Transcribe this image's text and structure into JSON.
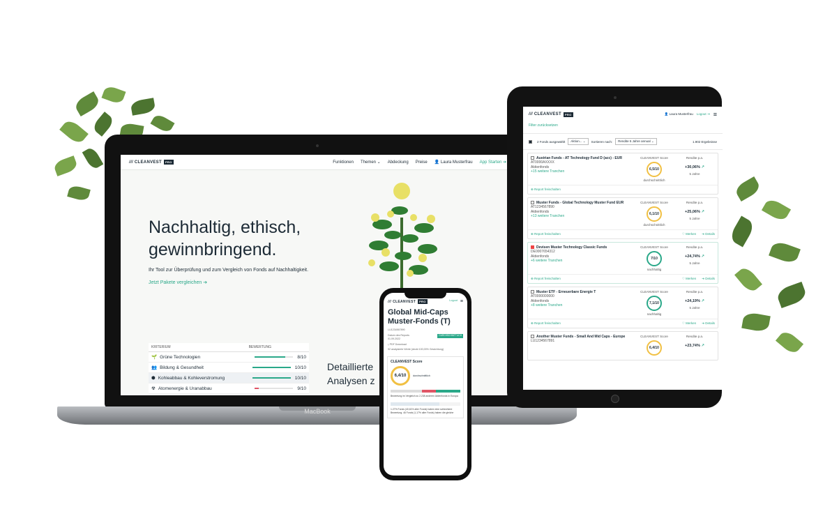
{
  "brand": {
    "name": "CLEANVEST",
    "badge": "PRO"
  },
  "colors": {
    "accent": "#2aa889",
    "dark": "#1d2b36",
    "score_yellow": "#f1c043"
  },
  "laptop": {
    "nav": {
      "items": [
        "Funktionen",
        "Themen",
        "Abdeckung",
        "Preise"
      ],
      "user": "Laura Musterfrau",
      "cta": "App Starten"
    },
    "hero": {
      "title_line1": "Nachhaltig, ethisch,",
      "title_line2": "gewinnbringend.",
      "subtitle": "Ihr Tool zur Überprüfung und zum Vergleich von Fonds auf Nachhaltigkeit.",
      "link": "Jetzt Pakete vergleichen"
    },
    "criteria": {
      "col1": "KRITERIUM",
      "col2": "BEWERTUNG",
      "rows": [
        {
          "label": "Grüne Technologien",
          "score": "8/10",
          "fill": 0.8,
          "color": "#2aa889"
        },
        {
          "label": "Bildung & Gesundheit",
          "score": "10/10",
          "fill": 1.0,
          "color": "#2aa889"
        },
        {
          "label": "Kohleabbau & Kohleverstromung",
          "score": "10/10",
          "fill": 1.0,
          "color": "#2aa889"
        },
        {
          "label": "Atomenergie & Uranabbau",
          "score": "9/10",
          "fill": 0.1,
          "color": "#e05566"
        }
      ]
    },
    "detail_line1": "Detaillierte",
    "detail_line2": "Analysen z",
    "device_label": "MacBook"
  },
  "tablet": {
    "nav": {
      "user": "Laura Musterfrau",
      "logout": "Logout"
    },
    "filter_link": "Filter zurücksetzen",
    "toolbar": {
      "selected": "2 Fonds ausgewählt",
      "select1": "Aktion...",
      "sort_label": "Sortieren nach:",
      "sort_value": "Rendite 5 Jahre annual",
      "results": "1.902 Ergebnisse"
    },
    "funds": [
      {
        "name": "Austrian Funds - AT Technology Fund D (acc) - EUR",
        "isin": "AT0000AXXXX",
        "type": "Aktienfonds",
        "tranches": "+15 weitere Tranchen",
        "score_label": "CLEANVEST Score",
        "score": "6,5/10",
        "rating": "durchschnittlich",
        "ret_label": "Rendite p.a.",
        "ret": "+30,06%",
        "period": "5 Jahre",
        "report": "Report freischalten",
        "checked": false,
        "green": false,
        "actions": []
      },
      {
        "name": "Muster Funds - Global Technology Muster Fund EUR",
        "isin": "AT1234567890",
        "type": "Aktienfonds",
        "tranches": "+13 weitere Tranchen",
        "score_label": "CLEANVEST Score",
        "score": "6,1/10",
        "rating": "durchschnittlich",
        "ret_label": "Rendite p.a.",
        "ret": "+25,06%",
        "period": "5 Jahre",
        "report": "Report freischalten",
        "checked": false,
        "green": false,
        "actions": [
          "Merken",
          "Details"
        ]
      },
      {
        "name": "Devisen Muster Technology Classic Funds",
        "isin": "DE0007654312",
        "type": "Aktienfonds",
        "tranches": "+6 weitere Tranchen",
        "score_label": "CLEANVEST Score",
        "score": "7/10",
        "rating": "nachhaltig",
        "ret_label": "Rendite p.a.",
        "ret": "+24,74%",
        "period": "5 Jahre",
        "report": "Report freischalten",
        "checked": true,
        "green": true,
        "actions": [
          "Merken",
          "Details"
        ]
      },
      {
        "name": "Muster ETF - Erneuerbare Energie T",
        "isin": "AT0000000000",
        "type": "Aktienfonds",
        "tranches": "+8 weitere Tranchen",
        "score_label": "CLEANVEST Score",
        "score": "7,1/10",
        "rating": "nachhaltig",
        "ret_label": "Rendite p.a.",
        "ret": "+24,19%",
        "period": "5 Jahre",
        "report": "Report freischalten",
        "checked": false,
        "green": true,
        "actions": [
          "Merken",
          "Details"
        ]
      },
      {
        "name": "Another Muster Funds - Small And Mid Caps - Europe",
        "isin": "LU1234567891",
        "type": "",
        "tranches": "",
        "score_label": "CLEANVEST Score",
        "score": "6,4/10",
        "rating": "",
        "ret_label": "Rendite p.a.",
        "ret": "+23,74%",
        "period": "",
        "report": "",
        "checked": false,
        "green": false,
        "actions": []
      }
    ]
  },
  "phone": {
    "nav": {
      "logout": "Logout"
    },
    "title_line1": "Global Mid-Caps",
    "title_line2": "Muster-Fonds (T)",
    "isin": "LU1234567890",
    "report_date_label": "Datum des Reports",
    "report_date": "01.09.2022",
    "tag": "DURCHSCHNITTLICH",
    "pdf": "PDF Download",
    "coverage": "92 analysierte Werte (deckt 100,00% Gewichtung)",
    "score_title": "CLEANVEST Score",
    "score": "6,4/10",
    "rating": "durchschnittlich",
    "compare_text": "Bewertung im Vergleich zu 2.238 anderen Aktienfonds in Europa",
    "bottom_text": "1.27% Fonds (40,61% aller Fonds) haben eine schlechtere Bewertung. 46 Fonds (1,17% aller Fonds) haben die gleiche"
  }
}
